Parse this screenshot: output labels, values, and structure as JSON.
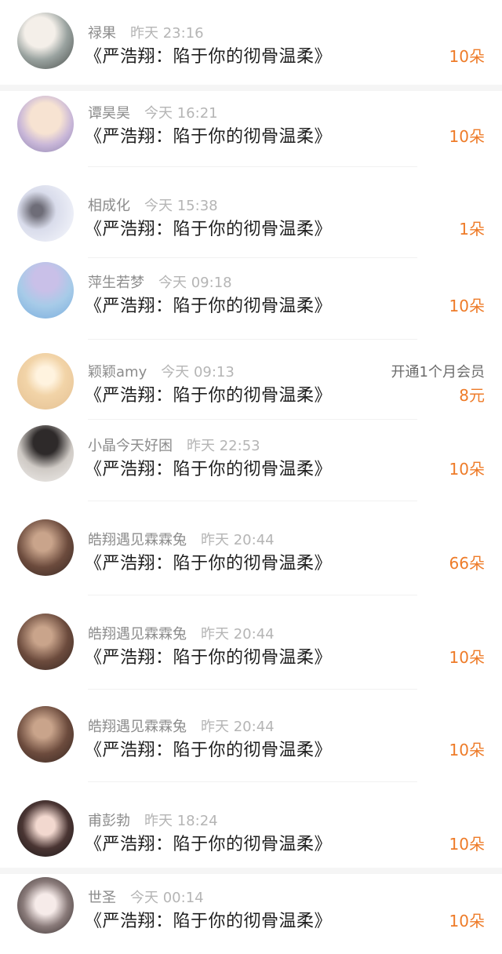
{
  "items": [
    {
      "name": "禄果",
      "time": "昨天 23:16",
      "book": "《严浩翔：陷于你的彻骨温柔》",
      "amount": "10朵",
      "extra": ""
    },
    {
      "name": "谭昊昊",
      "time": "今天 16:21",
      "book": "《严浩翔：陷于你的彻骨温柔》",
      "amount": "10朵",
      "extra": ""
    },
    {
      "name": "相成化",
      "time": "今天 15:38",
      "book": "《严浩翔：陷于你的彻骨温柔》",
      "amount": "1朵",
      "extra": ""
    },
    {
      "name": "萍生若梦",
      "time": "今天 09:18",
      "book": "《严浩翔：陷于你的彻骨温柔》",
      "amount": "10朵",
      "extra": ""
    },
    {
      "name": "颖颖amy",
      "time": "今天 09:13",
      "book": "《严浩翔：陷于你的彻骨温柔》",
      "amount": "8元",
      "extra": "开通1个月会员"
    },
    {
      "name": "小晶今天好困",
      "time": "昨天 22:53",
      "book": "《严浩翔：陷于你的彻骨温柔》",
      "amount": "10朵",
      "extra": ""
    },
    {
      "name": "皓翔遇见霖霖兔",
      "time": "昨天 20:44",
      "book": "《严浩翔：陷于你的彻骨温柔》",
      "amount": "66朵",
      "extra": ""
    },
    {
      "name": "皓翔遇见霖霖兔",
      "time": "昨天 20:44",
      "book": "《严浩翔：陷于你的彻骨温柔》",
      "amount": "10朵",
      "extra": ""
    },
    {
      "name": "皓翔遇见霖霖兔",
      "time": "昨天 20:44",
      "book": "《严浩翔：陷于你的彻骨温柔》",
      "amount": "10朵",
      "extra": ""
    },
    {
      "name": "甫彭勃",
      "time": "昨天 18:24",
      "book": "《严浩翔：陷于你的彻骨温柔》",
      "amount": "10朵",
      "extra": ""
    },
    {
      "name": "世圣",
      "time": "今天 00:14",
      "book": "《严浩翔：陷于你的彻骨温柔》",
      "amount": "10朵",
      "extra": ""
    }
  ],
  "colors": {
    "amount": "#ee7b28",
    "name": "#8c8c8c",
    "title": "#1f1f1f"
  }
}
